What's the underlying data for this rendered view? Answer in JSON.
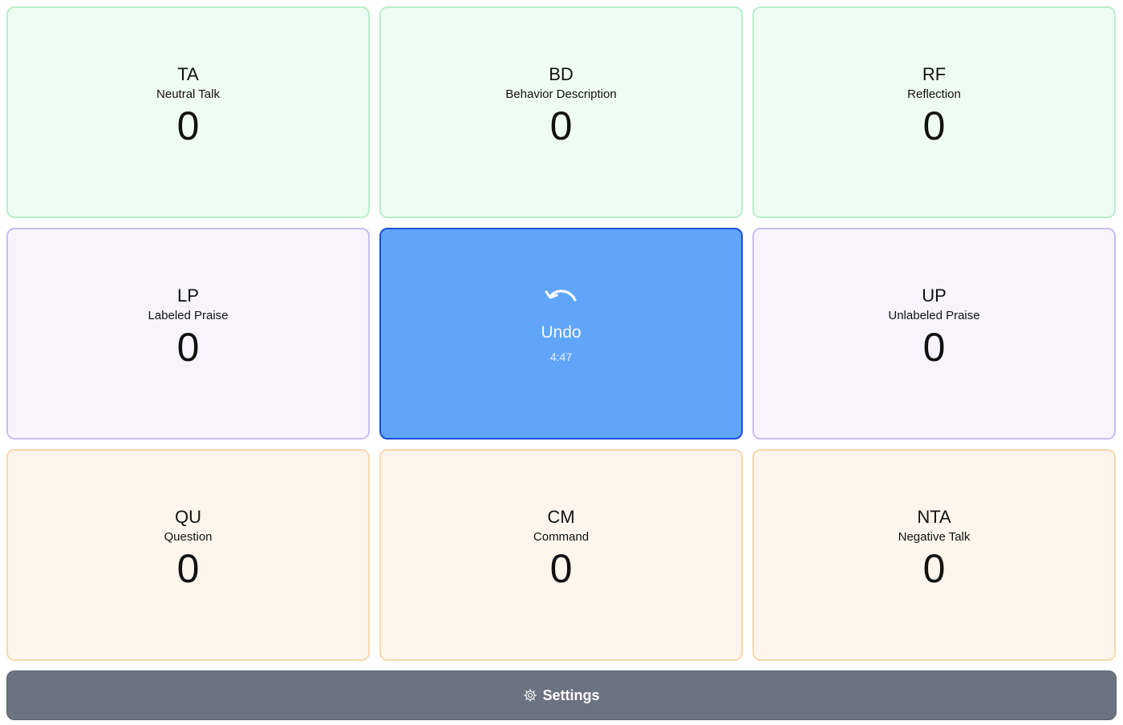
{
  "tiles": [
    {
      "code": "TA",
      "label": "Neutral Talk",
      "count": "0"
    },
    {
      "code": "BD",
      "label": "Behavior Description",
      "count": "0"
    },
    {
      "code": "RF",
      "label": "Reflection",
      "count": "0"
    },
    {
      "code": "LP",
      "label": "Labeled Praise",
      "count": "0"
    },
    {
      "code": "UP",
      "label": "Unlabeled Praise",
      "count": "0"
    },
    {
      "code": "QU",
      "label": "Question",
      "count": "0"
    },
    {
      "code": "CM",
      "label": "Command",
      "count": "0"
    },
    {
      "code": "NTA",
      "label": "Negative Talk",
      "count": "0"
    }
  ],
  "undo": {
    "label": "Undo",
    "time": "4:47",
    "icon": "undo-arrow-icon"
  },
  "settings": {
    "label": "Settings",
    "icon": "gear-icon"
  },
  "colors": {
    "green_bg": "#effcf3",
    "purple_bg": "#f7f4fe",
    "orange_bg": "#fef6ec",
    "undo_bg": "#60a5fa",
    "settings_bg": "#6b7280"
  }
}
